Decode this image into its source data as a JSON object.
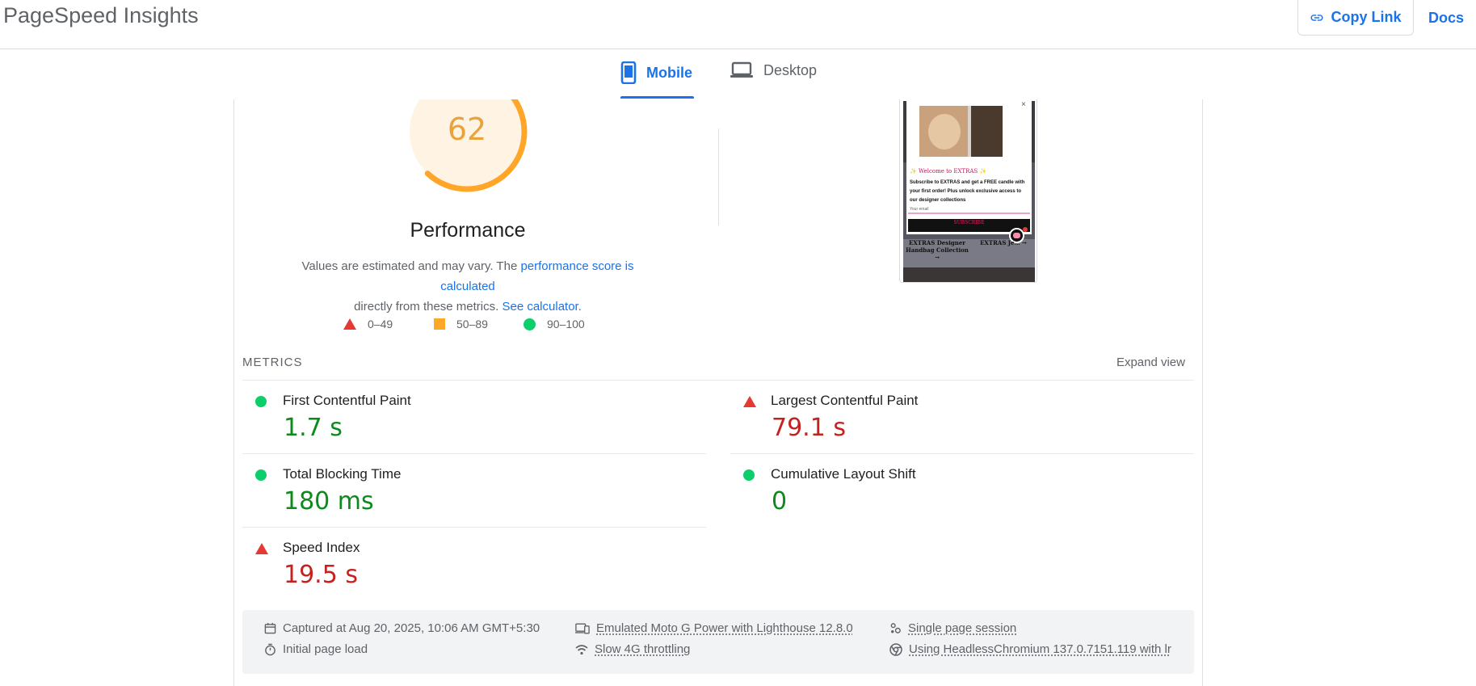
{
  "header": {
    "app_title": "PageSpeed Insights",
    "copy_link_label": "Copy Link",
    "docs_label": "Docs"
  },
  "tabs": [
    {
      "label": "Mobile",
      "active": true
    },
    {
      "label": "Desktop",
      "active": false
    }
  ],
  "performance": {
    "score": "62",
    "score_value": 62,
    "title": "Performance",
    "desc_before": "Values are estimated and may vary. The ",
    "desc_link1": "performance score is calculated",
    "desc_middle": "directly from these metrics.",
    "desc_link2": "See calculator."
  },
  "legend": [
    {
      "shape": "triangle",
      "color": "#e53935",
      "label": "0–49"
    },
    {
      "shape": "square",
      "color": "#ffa726",
      "label": "50–89"
    },
    {
      "shape": "circle",
      "color": "#0cce6b",
      "label": "90–100"
    }
  ],
  "screenshot_popup": {
    "welcome": "✨ Welcome to EXTRAS ✨",
    "body": "Subscribe to EXTRAS and get a FREE candle with your first order! Plus unlock exclusive access to our designer collections",
    "email_placeholder": "Your email",
    "button": "SUBSCRIBE",
    "close": "×",
    "collection_left": "EXTRAS Designer Handbag Collection →",
    "collection_right": "EXTRAS Je… →"
  },
  "metrics": {
    "section_label": "METRICS",
    "expand_label": "Expand view",
    "items": [
      {
        "title": "First Contentful Paint",
        "value": "1.7 s",
        "status": "good"
      },
      {
        "title": "Largest Contentful Paint",
        "value": "79.1 s",
        "status": "bad"
      },
      {
        "title": "Total Blocking Time",
        "value": "180 ms",
        "status": "good"
      },
      {
        "title": "Cumulative Layout Shift",
        "value": "0",
        "status": "good"
      },
      {
        "title": "Speed Index",
        "value": "19.5 s",
        "status": "bad"
      }
    ]
  },
  "footer": {
    "captured": "Captured at Aug 20, 2025, 10:06 AM GMT+5:30",
    "initial_load": "Initial page load",
    "device": "Emulated Moto G Power with Lighthouse 12.8.0",
    "throttling": "Slow 4G throttling",
    "session": "Single page session",
    "browser": "Using HeadlessChromium 137.0.7151.119 with lr"
  },
  "colors": {
    "accent": "#1a73e8",
    "average": "#ffa726",
    "good": "#0c8a1b",
    "bad": "#c5221f"
  }
}
